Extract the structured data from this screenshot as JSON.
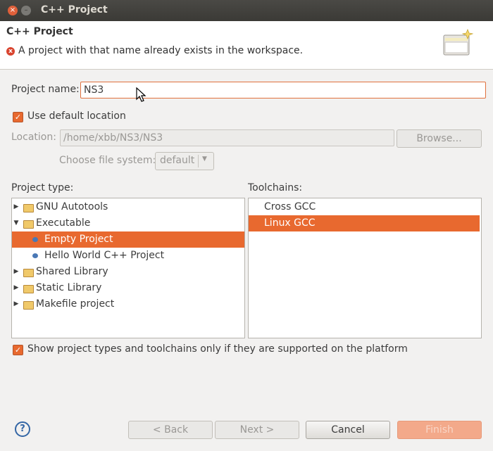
{
  "window": {
    "title": "C++ Project",
    "close_glyph": "×",
    "min_glyph": "–"
  },
  "header": {
    "title": "C++ Project",
    "error_glyph": "x",
    "error_message": "A project with that name already exists in the workspace."
  },
  "form": {
    "project_name_label": "Project name:",
    "project_name_value": "NS3",
    "use_default_label": "Use default location",
    "location_label": "Location:",
    "location_value": "/home/xbb/NS3/NS3",
    "browse_label": "Browse...",
    "file_system_label": "Choose file system:",
    "file_system_value": "default",
    "checkmark": "✓"
  },
  "project_types": {
    "label": "Project type:",
    "items": [
      {
        "label": "GNU Autotools",
        "twist": "▶"
      },
      {
        "label": "Executable",
        "twist": "▼"
      },
      {
        "label": "Empty Project"
      },
      {
        "label": "Hello World C++ Project"
      },
      {
        "label": "Shared Library",
        "twist": "▶"
      },
      {
        "label": "Static Library",
        "twist": "▶"
      },
      {
        "label": "Makefile project",
        "twist": "▶"
      }
    ]
  },
  "toolchains": {
    "label": "Toolchains:",
    "items": [
      "Cross GCC",
      "Linux GCC"
    ]
  },
  "filter_label": "Show project types and toolchains only if they are supported on the platform",
  "buttons": {
    "help": "?",
    "back": "< Back",
    "next": "Next >",
    "cancel": "Cancel",
    "finish": "Finish"
  },
  "combo_arrow": "▼",
  "colors": {
    "accent": "#e8692f",
    "titlebar": "#3b3a36",
    "error": "#d9442f"
  }
}
